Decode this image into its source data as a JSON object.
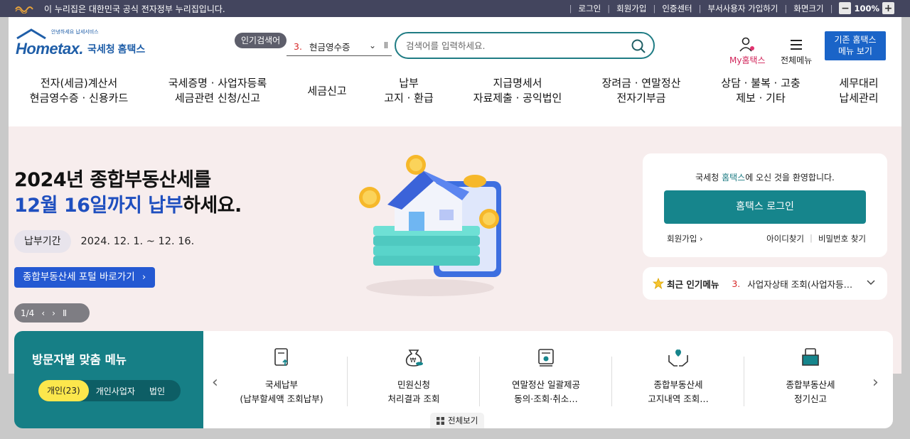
{
  "govbar": {
    "notice": "이 누리집은 대한민국 공식 전자정부 누리집입니다.",
    "links": [
      "로그인",
      "회원가입",
      "인증센터",
      "부서사용자 가입하기"
    ],
    "zoom_label": "화면크기",
    "zoom_value": "100%"
  },
  "brand": {
    "logo_text": "Hometax.",
    "tagline": "국세청 홈택스",
    "subtag": "안녕하세요 납세서비스"
  },
  "popular_search": {
    "badge": "인기검색어",
    "rank": "3.",
    "term": "현금영수증"
  },
  "search": {
    "placeholder": "검색어를 입력하세요."
  },
  "utility": {
    "my": "My홈택스",
    "all": "전체메뉴",
    "legacy_line1": "기존 홈택스",
    "legacy_line2": "메뉴 보기"
  },
  "nav": [
    {
      "l1": "전자(세금)계산서",
      "l2": "현금영수증 · 신용카드"
    },
    {
      "l1": "국세증명 · 사업자등록",
      "l2": "세금관련 신청/신고"
    },
    {
      "l1": "세금신고",
      "l2": ""
    },
    {
      "l1": "납부",
      "l2": "고지 · 환급"
    },
    {
      "l1": "지급명세서",
      "l2": "자료제출 · 공익법인"
    },
    {
      "l1": "장려금 · 연말정산",
      "l2": "전자기부금"
    },
    {
      "l1": "상담 · 불복 · 고충",
      "l2": "제보 · 기타"
    },
    {
      "l1": "세무대리",
      "l2": "납세관리"
    }
  ],
  "hero": {
    "title_line1": "2024년 종합부동산세를",
    "title_highlight": "12월 16일까지 납부",
    "title_tail": "하세요.",
    "period_label": "납부기간",
    "period_date": "2024. 12. 1. ~ 12. 16.",
    "portal_button": "종합부동산세 포털 바로가기",
    "slide_counter": "1/4"
  },
  "login": {
    "welcome_pre": "국세청 ",
    "welcome_brand": "홈택스",
    "welcome_post": "에 오신 것을 환영합니다.",
    "button": "홈택스 로그인",
    "join": "회원가입",
    "find_id": "아이디찾기",
    "find_pw": "비밀번호 찾기"
  },
  "popular_menu": {
    "title": "최근 인기메뉴",
    "rank": "3.",
    "item": "사업자상태 조회(사업자등…"
  },
  "visitor": {
    "title": "방문자별 맞춤 메뉴",
    "tabs": [
      "개인(23)",
      "개인사업자",
      "법인"
    ]
  },
  "quick_menu": [
    {
      "l1": "국세납부",
      "l2": "(납부할세액 조회납부)"
    },
    {
      "l1": "민원신청",
      "l2": "처리결과 조회"
    },
    {
      "l1": "연말정산 일괄제공",
      "l2": "동의·조회·취소…"
    },
    {
      "l1": "종합부동산세",
      "l2": "고지내역 조회…"
    },
    {
      "l1": "종합부동산세",
      "l2": "정기신고"
    }
  ],
  "all_view": "전체보기",
  "colors": {
    "teal": "#167f86",
    "blue": "#1f4fbf",
    "gov_bar": "#43455e",
    "hero_bg": "#f7eded"
  }
}
